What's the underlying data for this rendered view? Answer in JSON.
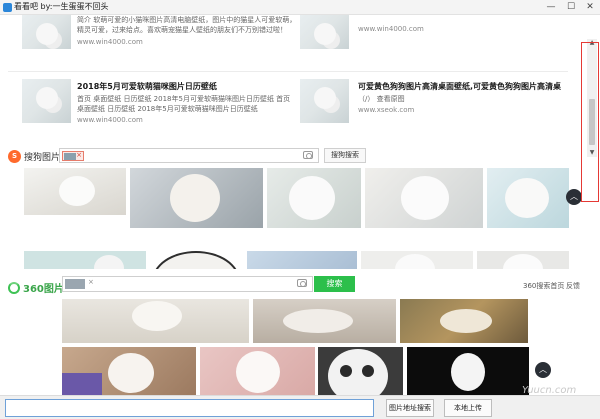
{
  "window": {
    "title": "看看吧 by:一生蛋蛋不回头",
    "minimize_glyph": "—",
    "maximize_glyph": "☐",
    "close_glyph": "✕"
  },
  "results": [
    {
      "title": "",
      "desc_lines": [
        "简介 软萌可爱的小猫咪图片高清电脑壁纸，图片中的猫星人可爱软萌，",
        "精灵可爱，过来给点。喜欢萌宠猫星人壁纸的朋友们不万别错过啦！"
      ],
      "source": "www.win4000.com"
    },
    {
      "title": "",
      "desc_lines": [],
      "source": "www.win4000.com"
    },
    {
      "title": "2018年5月可爱软萌猫咪图片日历壁纸",
      "desc_lines": [
        "首页 桌面壁纸 日历壁纸 2018年5月可爱软萌猫咪图片日历壁纸 首页",
        "桌面壁纸 日历壁纸 2018年5月可爱软萌猫咪图片日历壁纸"
      ],
      "source": "www.win4000.com"
    },
    {
      "title": "可爱黄色狗狗图片高清桌面壁纸,可爱黄色狗狗图片高清桌",
      "desc_lines": [
        "（/） 查看原图"
      ],
      "source": "www.xseok.com"
    }
  ],
  "sogou": {
    "logo_mark": "S",
    "logo_text": "搜狗图片",
    "chip_close": "×",
    "search_button": "搜狗搜索"
  },
  "s360": {
    "logo_text": "360图片",
    "chip_close": "×",
    "search_button": "搜索",
    "help_link": "360搜索首页",
    "feedback_link": "反馈"
  },
  "scroll": {
    "up_glyph": "▲",
    "down_glyph": "▼"
  },
  "back_to_top_glyph": "︿",
  "bottom": {
    "url_value": "",
    "address_search_button": "图片地址搜索",
    "local_upload_button": "本地上传"
  },
  "watermark": "Yuucn.com",
  "colors": {
    "sogou_orange": "#ff6a2c",
    "s360_green": "#2cbf4b",
    "highlight_red": "#e53935"
  }
}
